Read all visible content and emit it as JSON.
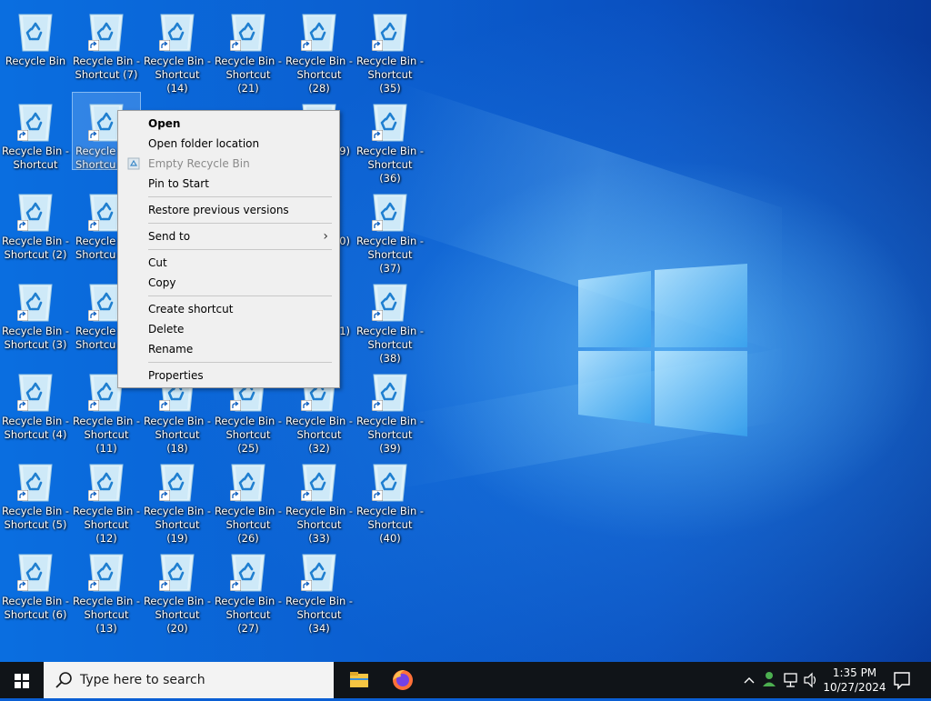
{
  "desktop": {
    "icons": [
      {
        "label": "Recycle Bin",
        "shortcut": false
      },
      {
        "label": "Recycle Bin -\nShortcut (7)",
        "shortcut": true
      },
      {
        "label": "Recycle Bin -\nShortcut (14)",
        "shortcut": true
      },
      {
        "label": "Recycle Bin -\nShortcut (21)",
        "shortcut": true
      },
      {
        "label": "Recycle Bin -\nShortcut (28)",
        "shortcut": true
      },
      {
        "label": "Recycle Bin -\nShortcut (35)",
        "shortcut": true
      },
      {
        "label": "Recycle Bin -\nShortcut",
        "shortcut": true
      },
      {
        "label": "Recycle Bin -\nShortcut (8)",
        "shortcut": true
      },
      {
        "label": "Recycle Bin -\nShortcut (36)",
        "shortcut": true
      },
      {
        "label": "Recycle Bin -\nShortcut (2)",
        "shortcut": true
      },
      {
        "label": "Recycle Bin -\nShortcut (37)",
        "shortcut": true
      },
      {
        "label": "Recycle Bin -\nShortcut (3)",
        "shortcut": true
      },
      {
        "label": "Recycle Bin -\nShortcut (38)",
        "shortcut": true
      },
      {
        "label": "Recycle Bin -\nShortcut (4)",
        "shortcut": true
      },
      {
        "label": "Recycle Bin -\nShortcut (11)",
        "shortcut": true
      },
      {
        "label": "Recycle Bin -\nShortcut (18)",
        "shortcut": true
      },
      {
        "label": "Recycle Bin -\nShortcut (25)",
        "shortcut": true
      },
      {
        "label": "Recycle Bin -\nShortcut (32)",
        "shortcut": true
      },
      {
        "label": "Recycle Bin -\nShortcut (39)",
        "shortcut": true
      },
      {
        "label": "Recycle Bin -\nShortcut (5)",
        "shortcut": true
      },
      {
        "label": "Recycle Bin -\nShortcut (12)",
        "shortcut": true
      },
      {
        "label": "Recycle Bin -\nShortcut (19)",
        "shortcut": true
      },
      {
        "label": "Recycle Bin -\nShortcut (26)",
        "shortcut": true
      },
      {
        "label": "Recycle Bin -\nShortcut (33)",
        "shortcut": true
      },
      {
        "label": "Recycle Bin -\nShortcut (40)",
        "shortcut": true
      },
      {
        "label": "Recycle Bin -\nShortcut (6)",
        "shortcut": true
      },
      {
        "label": "Recycle Bin -\nShortcut (13)",
        "shortcut": true
      },
      {
        "label": "Recycle Bin -\nShortcut (20)",
        "shortcut": true
      },
      {
        "label": "Recycle Bin -\nShortcut (27)",
        "shortcut": true
      },
      {
        "label": "Recycle Bin -\nShortcut (34)",
        "shortcut": true
      }
    ],
    "partial_labels": {
      "r2c2": "Recycle I\nShortcu",
      "r3c2": "Recycle I\nShortcu",
      "r4c2": "Recycle I\nShortcu",
      "r2c5": "9)",
      "r3c5": "0)",
      "r4c5": "1)"
    }
  },
  "context_menu": {
    "open": "Open",
    "open_folder_location": "Open folder location",
    "empty_recycle_bin": "Empty Recycle Bin",
    "pin_to_start": "Pin to Start",
    "restore_previous_versions": "Restore previous versions",
    "send_to": "Send to",
    "cut": "Cut",
    "copy": "Copy",
    "create_shortcut": "Create shortcut",
    "delete": "Delete",
    "rename": "Rename",
    "properties": "Properties"
  },
  "taskbar": {
    "search_placeholder": "Type here to search",
    "time": "1:35 PM",
    "date": "10/27/2024",
    "pinned": [
      "file-explorer-icon",
      "firefox-icon"
    ]
  },
  "colors": {
    "taskbar_bg": "#101418",
    "menu_bg": "#f0f0f0",
    "desktop_accent": "#0a5fd4"
  }
}
